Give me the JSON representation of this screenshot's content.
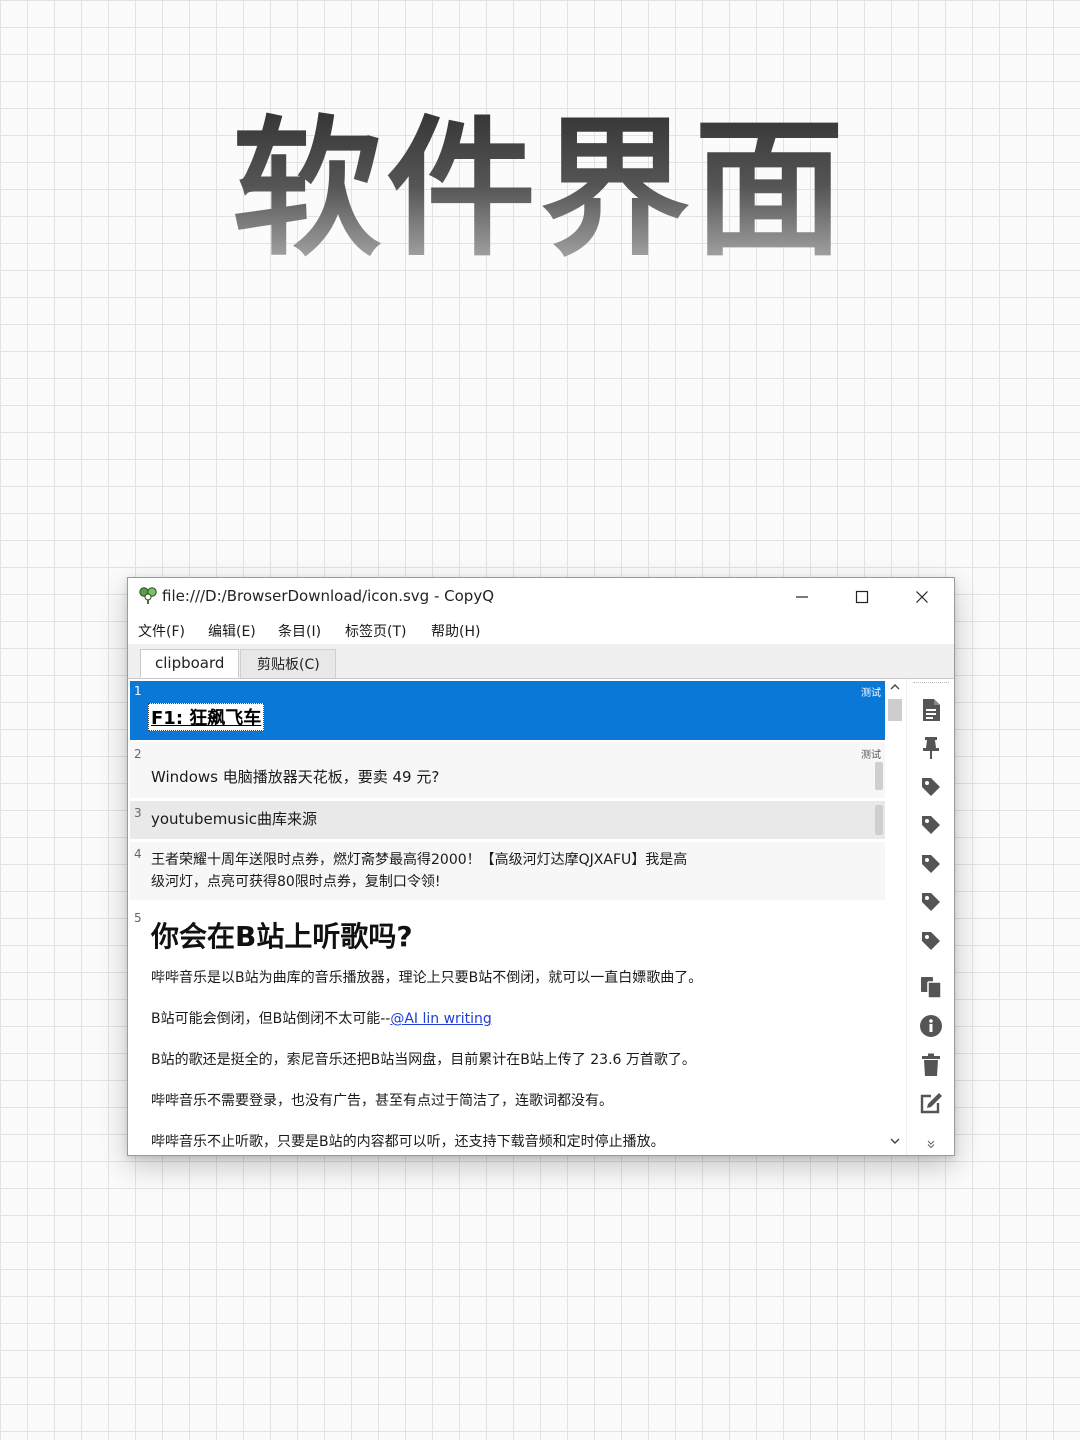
{
  "hero": {
    "title": "软件界面"
  },
  "window": {
    "title": "file:///D:/BrowserDownload/icon.svg - CopyQ",
    "controls": {
      "minimize": "minimize",
      "maximize": "maximize",
      "close": "close"
    }
  },
  "menu": [
    "文件(F)",
    "编辑(E)",
    "条目(I)",
    "标签页(T)",
    "帮助(H)"
  ],
  "tabs": [
    {
      "label": "clipboard",
      "active": true
    },
    {
      "label": "剪贴板(C)",
      "active": false
    }
  ],
  "items": [
    {
      "num": "1",
      "tag": "测试",
      "text": "F1: 狂飙飞车"
    },
    {
      "num": "2",
      "tag": "测试",
      "text": "Windows 电脑播放器天花板，要卖 49 元?"
    },
    {
      "num": "3",
      "text": "youtubemusic曲库来源"
    },
    {
      "num": "4",
      "line1": "王者荣耀十周年送限时点券，燃灯斋梦最高得2000！【高级河灯达摩QJXAFU】我是高",
      "line2": "级河灯，点亮可获得80限时点券，复制口令领!"
    },
    {
      "num": "5",
      "heading": "你会在B站上听歌吗?",
      "paragraphs": [
        "哔哔音乐是以B站为曲库的音乐播放器，理论上只要B站不倒闭，就可以一直白嫖歌曲了。",
        "B站可能会倒闭，但B站倒闭不太可能--",
        "B站的歌还是挺全的，索尼音乐还把B站当网盘，目前累计在B站上传了 23.6 万首歌了。",
        "哔哔音乐不需要登录，也没有广告，甚至有点过于简洁了，连歌词都没有。",
        "哔哔音乐不止听歌，只要是B站的内容都可以听，还支持下载音频和定时停止播放。"
      ],
      "link": "@AI lin writing"
    }
  ],
  "toolbar_icons": [
    "document-icon",
    "pin-icon",
    "tag-icon",
    "tag-icon",
    "tag-icon",
    "tag-icon",
    "tag-icon",
    "copy-icon",
    "info-icon",
    "trash-icon",
    "edit-icon"
  ],
  "colors": {
    "selection": "#0a78d7",
    "link": "#1e3ed8",
    "toolbar_icon": "#555555"
  }
}
